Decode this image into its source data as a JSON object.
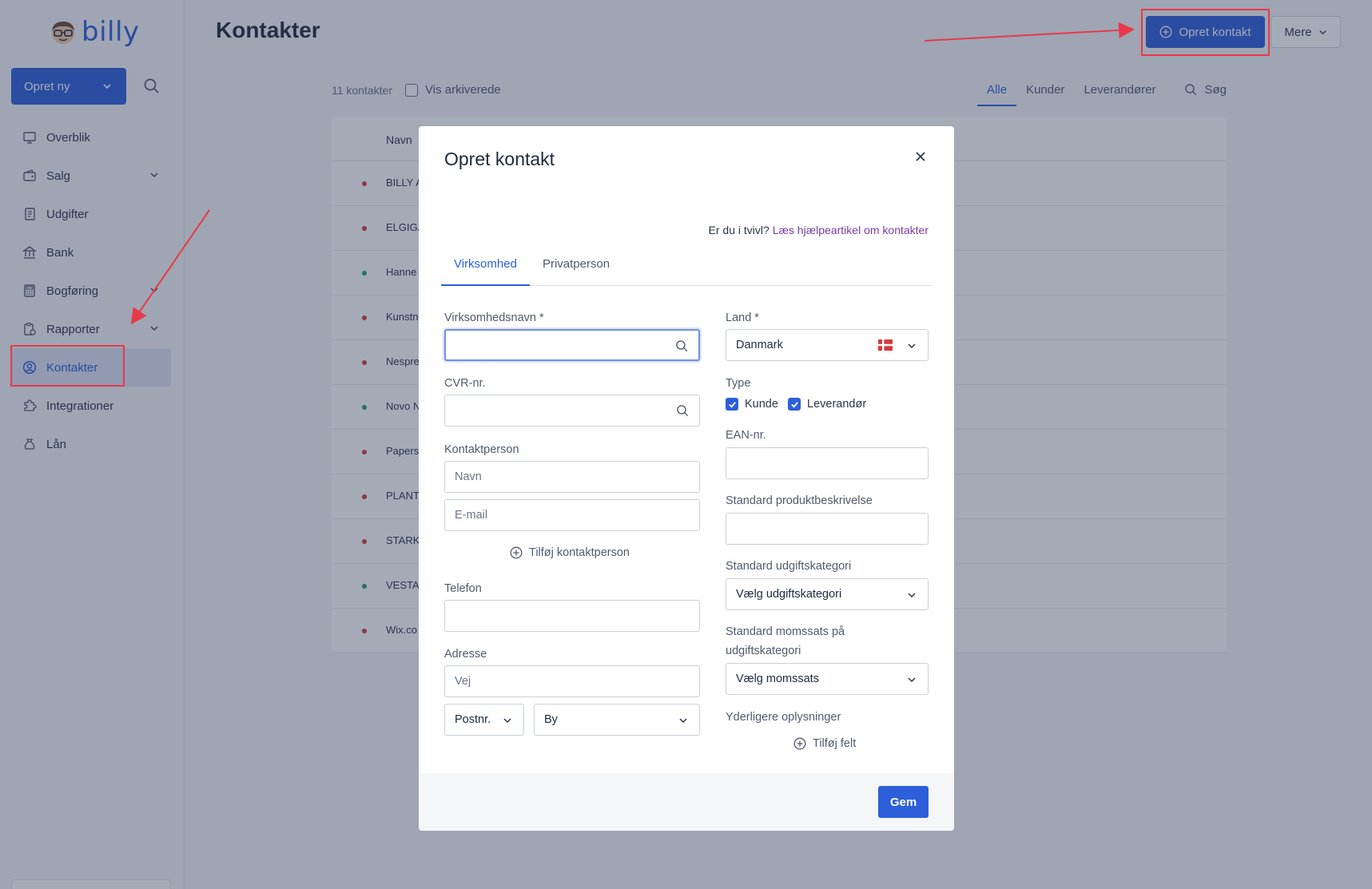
{
  "app": {
    "logo_text": "billy",
    "create_new_label": "Opret ny"
  },
  "sidebar": {
    "items": [
      {
        "label": "Overblik",
        "icon": "monitor-icon",
        "has_chevron": false,
        "active": false
      },
      {
        "label": "Salg",
        "icon": "wallet-icon",
        "has_chevron": true,
        "active": false
      },
      {
        "label": "Udgifter",
        "icon": "receipt-icon",
        "has_chevron": false,
        "active": false
      },
      {
        "label": "Bank",
        "icon": "bank-icon",
        "has_chevron": false,
        "active": false
      },
      {
        "label": "Bogføring",
        "icon": "calculator-icon",
        "has_chevron": true,
        "active": false
      },
      {
        "label": "Rapporter",
        "icon": "report-icon",
        "has_chevron": true,
        "active": false
      },
      {
        "label": "Kontakter",
        "icon": "user-circle-icon",
        "has_chevron": false,
        "active": true
      },
      {
        "label": "Integrationer",
        "icon": "puzzle-icon",
        "has_chevron": false,
        "active": false
      },
      {
        "label": "Lån",
        "icon": "money-bag-icon",
        "has_chevron": false,
        "active": false
      }
    ]
  },
  "header": {
    "title": "Kontakter",
    "create_contact_label": "Opret kontakt",
    "more_label": "Mere"
  },
  "toolbar": {
    "count": "11 kontakter",
    "show_archived_label": "Vis arkiverede",
    "filters": [
      "Alle",
      "Kunder",
      "Leverandører"
    ],
    "active_filter": "Alle",
    "search_label": "Søg"
  },
  "table": {
    "column_header": "Navn",
    "rows": [
      {
        "name": "BILLY A",
        "status": "red"
      },
      {
        "name": "ELGIGA",
        "status": "red"
      },
      {
        "name": "Hanne",
        "status": "green"
      },
      {
        "name": "Kunstn",
        "status": "red"
      },
      {
        "name": "Nespre",
        "status": "red"
      },
      {
        "name": "Novo N",
        "status": "green"
      },
      {
        "name": "Papers",
        "status": "red"
      },
      {
        "name": "PLANT",
        "status": "red"
      },
      {
        "name": "STARK",
        "status": "red"
      },
      {
        "name": "VESTA",
        "status": "green"
      },
      {
        "name": "Wix.co",
        "status": "red"
      }
    ]
  },
  "modal": {
    "title": "Opret kontakt",
    "help_prefix": "Er du i tvivl?",
    "help_link": "Læs hjælpeartikel om kontakter",
    "tabs": [
      "Virksomhed",
      "Privatperson"
    ],
    "active_tab": "Virksomhed",
    "left": {
      "company_name_label": "Virksomhedsnavn *",
      "company_name_value": "",
      "cvr_label": "CVR-nr.",
      "cvr_value": "",
      "contact_person_label": "Kontaktperson",
      "name_placeholder": "Navn",
      "email_placeholder": "E-mail",
      "add_contact_person": "Tilføj kontaktperson",
      "phone_label": "Telefon",
      "address_label": "Adresse",
      "street_placeholder": "Vej",
      "zip_placeholder": "Postnr.",
      "city_placeholder": "By"
    },
    "right": {
      "country_label": "Land *",
      "country_value": "Danmark",
      "type_label": "Type",
      "type_options": [
        {
          "label": "Kunde",
          "checked": true
        },
        {
          "label": "Leverandør",
          "checked": true
        }
      ],
      "ean_label": "EAN-nr.",
      "product_desc_label": "Standard produktbeskrivelse",
      "expense_cat_label": "Standard udgiftskategori",
      "expense_cat_value": "Vælg udgiftskategori",
      "vat_label_line1": "Standard momssats på",
      "vat_label_line2": "udgiftskategori",
      "vat_value": "Vælg momssats",
      "extra_info_label": "Yderligere oplysninger",
      "add_field": "Tilføj felt"
    },
    "save_label": "Gem"
  },
  "colors": {
    "primary": "#2c5fd9",
    "annotation": "#e8394a",
    "status_red": "#d7383b",
    "status_green": "#1fa46b",
    "link": "#7a3aa6"
  }
}
